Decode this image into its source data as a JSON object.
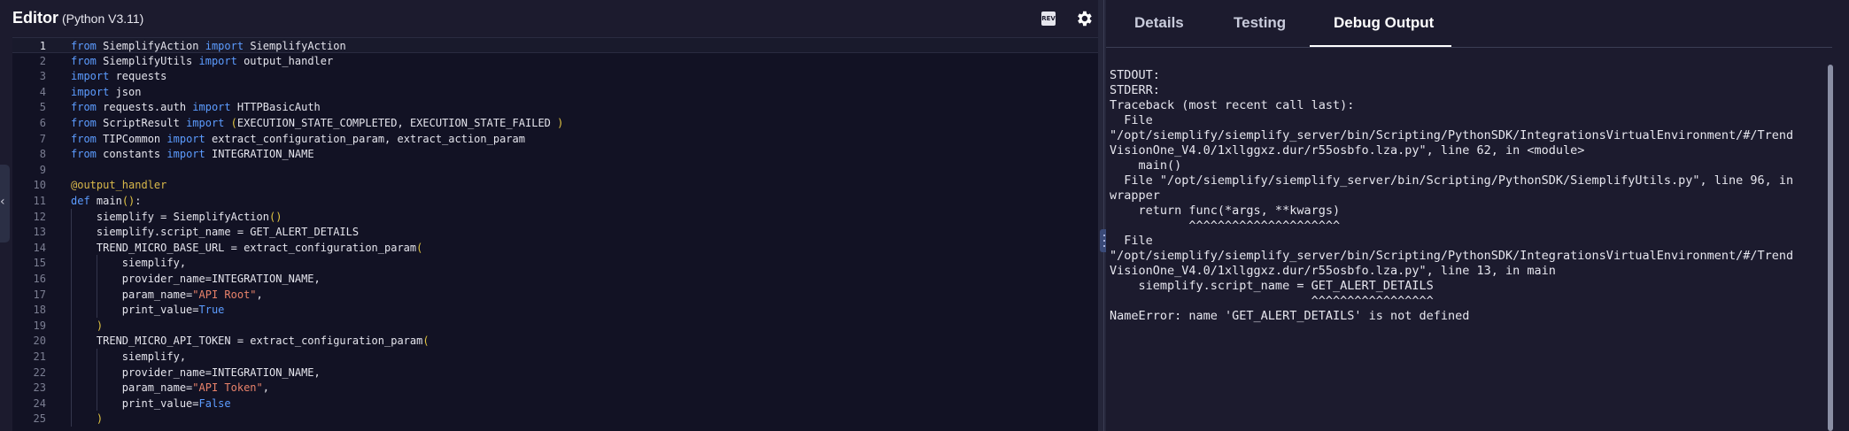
{
  "editor": {
    "title": "Editor",
    "version": "(Python V3.11)",
    "rev_label": "REV",
    "collapse_glyph": "‹",
    "lines": [
      {
        "n": "1",
        "segs": [
          [
            "kw",
            "from"
          ],
          [
            "t",
            " SiemplifyAction "
          ],
          [
            "kw",
            "import"
          ],
          [
            "t",
            " SiemplifyAction"
          ]
        ]
      },
      {
        "n": "2",
        "segs": [
          [
            "kw",
            "from"
          ],
          [
            "t",
            " SiemplifyUtils "
          ],
          [
            "kw",
            "import"
          ],
          [
            "t",
            " output_handler"
          ]
        ]
      },
      {
        "n": "3",
        "segs": [
          [
            "kw",
            "import"
          ],
          [
            "t",
            " requests"
          ]
        ]
      },
      {
        "n": "4",
        "segs": [
          [
            "kw",
            "import"
          ],
          [
            "t",
            " json"
          ]
        ]
      },
      {
        "n": "5",
        "segs": [
          [
            "kw",
            "from"
          ],
          [
            "t",
            " requests.auth "
          ],
          [
            "kw",
            "import"
          ],
          [
            "t",
            " HTTPBasicAuth"
          ]
        ]
      },
      {
        "n": "6",
        "segs": [
          [
            "kw",
            "from"
          ],
          [
            "t",
            " ScriptResult "
          ],
          [
            "kw",
            "import"
          ],
          [
            "t",
            " "
          ],
          [
            "paren",
            "("
          ],
          [
            "t",
            "EXECUTION_STATE_COMPLETED, EXECUTION_STATE_FAILED "
          ],
          [
            "paren",
            ")"
          ]
        ]
      },
      {
        "n": "7",
        "segs": [
          [
            "kw",
            "from"
          ],
          [
            "t",
            " TIPCommon "
          ],
          [
            "kw",
            "import"
          ],
          [
            "t",
            " extract_configuration_param, extract_action_param"
          ]
        ]
      },
      {
        "n": "8",
        "segs": [
          [
            "kw",
            "from"
          ],
          [
            "t",
            " constants "
          ],
          [
            "kw",
            "import"
          ],
          [
            "t",
            " INTEGRATION_NAME"
          ]
        ]
      },
      {
        "n": "9",
        "segs": []
      },
      {
        "n": "10",
        "segs": [
          [
            "dec",
            "@output_handler"
          ]
        ]
      },
      {
        "n": "11",
        "segs": [
          [
            "kw",
            "def"
          ],
          [
            "t",
            " main"
          ],
          [
            "paren",
            "()"
          ],
          [
            "t",
            ":"
          ]
        ]
      },
      {
        "n": "12",
        "segs": [
          [
            "t",
            "    siemplify = SiemplifyAction"
          ],
          [
            "paren",
            "()"
          ]
        ]
      },
      {
        "n": "13",
        "segs": [
          [
            "t",
            "    siemplify.script_name = GET_ALERT_DETAILS"
          ]
        ]
      },
      {
        "n": "14",
        "segs": [
          [
            "t",
            "    TREND_MICRO_BASE_URL = extract_configuration_param"
          ],
          [
            "paren",
            "("
          ]
        ]
      },
      {
        "n": "15",
        "segs": [
          [
            "t",
            "        siemplify,"
          ]
        ]
      },
      {
        "n": "16",
        "segs": [
          [
            "t",
            "        provider_name=INTEGRATION_NAME,"
          ]
        ]
      },
      {
        "n": "17",
        "segs": [
          [
            "t",
            "        param_name="
          ],
          [
            "str",
            "\"API Root\""
          ],
          [
            "t",
            ","
          ]
        ]
      },
      {
        "n": "18",
        "segs": [
          [
            "t",
            "        print_value="
          ],
          [
            "kw",
            "True"
          ]
        ]
      },
      {
        "n": "19",
        "segs": [
          [
            "t",
            "    "
          ],
          [
            "paren",
            ")"
          ]
        ]
      },
      {
        "n": "20",
        "segs": [
          [
            "t",
            "    TREND_MICRO_API_TOKEN = extract_configuration_param"
          ],
          [
            "paren",
            "("
          ]
        ]
      },
      {
        "n": "21",
        "segs": [
          [
            "t",
            "        siemplify,"
          ]
        ]
      },
      {
        "n": "22",
        "segs": [
          [
            "t",
            "        provider_name=INTEGRATION_NAME,"
          ]
        ]
      },
      {
        "n": "23",
        "segs": [
          [
            "t",
            "        param_name="
          ],
          [
            "str",
            "\"API Token\""
          ],
          [
            "t",
            ","
          ]
        ]
      },
      {
        "n": "24",
        "segs": [
          [
            "t",
            "        print_value="
          ],
          [
            "kw",
            "False"
          ]
        ]
      },
      {
        "n": "25",
        "segs": [
          [
            "t",
            "    "
          ],
          [
            "paren",
            ")"
          ]
        ]
      }
    ]
  },
  "tabs": [
    {
      "label": "Details",
      "active": false
    },
    {
      "label": "Testing",
      "active": false
    },
    {
      "label": "Debug Output",
      "active": true
    }
  ],
  "debug_output": {
    "lines": [
      "STDOUT:",
      "STDERR:",
      "Traceback (most recent call last):",
      "  File",
      "\"/opt/siemplify/siemplify_server/bin/Scripting/PythonSDK/IntegrationsVirtualEnvironment/#/Trend",
      "VisionOne_V4.0/1xllggxz.dur/r55osbfo.lza.py\", line 62, in <module>",
      "    main()",
      "  File \"/opt/siemplify/siemplify_server/bin/Scripting/PythonSDK/SiemplifyUtils.py\", line 96, in",
      "wrapper",
      "    return func(*args, **kwargs)",
      "           ^^^^^^^^^^^^^^^^^^^^^",
      "  File",
      "\"/opt/siemplify/siemplify_server/bin/Scripting/PythonSDK/IntegrationsVirtualEnvironment/#/Trend",
      "VisionOne_V4.0/1xllggxz.dur/r55osbfo.lza.py\", line 13, in main",
      "    siemplify.script_name = GET_ALERT_DETAILS",
      "                            ^^^^^^^^^^^^^^^^^",
      "NameError: name 'GET_ALERT_DETAILS' is not defined"
    ]
  }
}
